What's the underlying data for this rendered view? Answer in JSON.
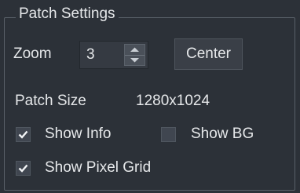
{
  "group": {
    "title": "Patch Settings"
  },
  "zoom": {
    "label": "Zoom",
    "value": "3",
    "up_icon": "arrow-up-icon",
    "down_icon": "arrow-down-icon"
  },
  "center_button": {
    "label": "Center"
  },
  "patch_size": {
    "label": "Patch Size",
    "value": "1280x1024"
  },
  "checkboxes": {
    "show_info": {
      "label": "Show Info",
      "checked": true
    },
    "show_bg": {
      "label": "Show BG",
      "checked": false
    },
    "show_pixel_grid": {
      "label": "Show Pixel Grid",
      "checked": true
    }
  }
}
